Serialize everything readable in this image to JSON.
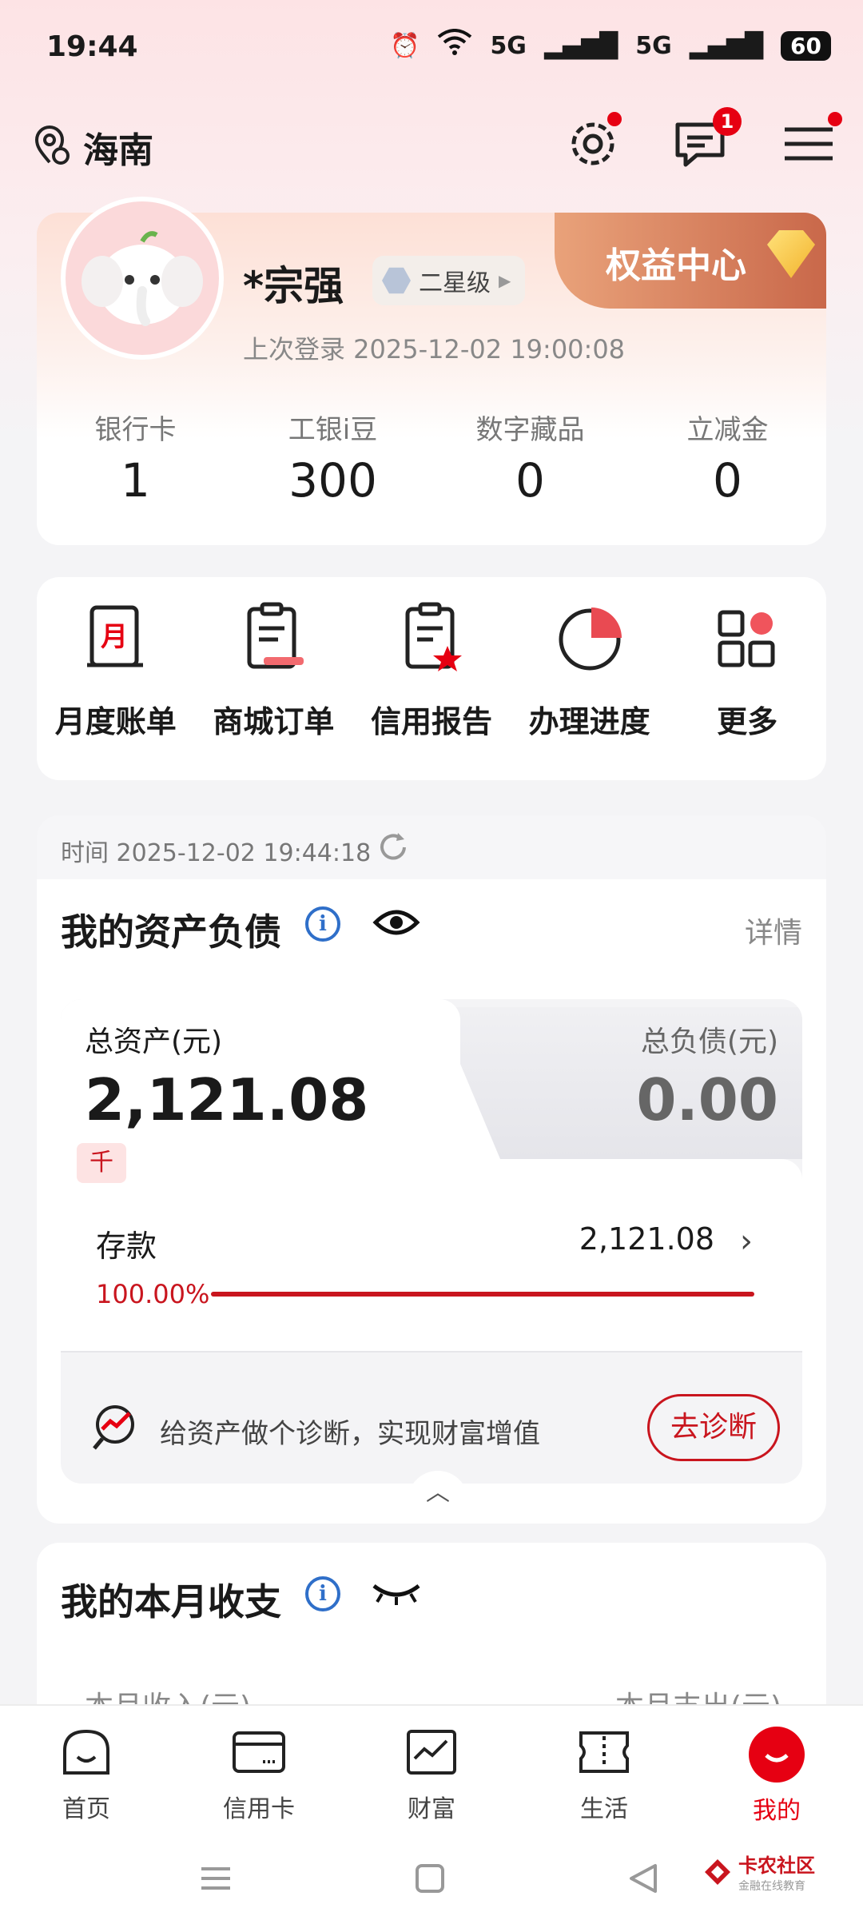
{
  "status_bar": {
    "time": "19:44",
    "signal1": "5G",
    "signal2": "5G",
    "battery": "60"
  },
  "header": {
    "location": "海南",
    "messages_badge": "1"
  },
  "profile": {
    "name": "*宗强",
    "level": "二星级",
    "rights_center": "权益中心",
    "last_login": "上次登录 2025-12-02 19:00:08",
    "stats": [
      {
        "label": "银行卡",
        "value": "1"
      },
      {
        "label": "工银i豆",
        "value": "300"
      },
      {
        "label": "数字藏品",
        "value": "0"
      },
      {
        "label": "立减金",
        "value": "0"
      }
    ]
  },
  "quick_menu": [
    {
      "label": "月度账单",
      "icon": "monthly-bill-icon"
    },
    {
      "label": "商城订单",
      "icon": "mall-order-icon"
    },
    {
      "label": "信用报告",
      "icon": "credit-report-icon"
    },
    {
      "label": "办理进度",
      "icon": "progress-pie-icon"
    },
    {
      "label": "更多",
      "icon": "more-grid-icon"
    }
  ],
  "assets": {
    "time": "时间 2025-12-02 19:44:18",
    "title": "我的资产负债",
    "details": "详情",
    "total_assets_label": "总资产(元)",
    "total_assets_value": "2,121.08",
    "unit_tag": "千",
    "total_debt_label": "总负债(元)",
    "total_debt_value": "0.00",
    "deposit_label": "存款",
    "deposit_value": "2,121.08",
    "deposit_percent": "100.00%",
    "deposit_fraction": 1.0,
    "diagnosis_text": "给资产做个诊断，实现财富增值",
    "diagnosis_button": "去诊断"
  },
  "monthly": {
    "title": "我的本月收支",
    "income_label": "本月收入(元)",
    "expense_label": "本月支出(元)"
  },
  "bottom_nav": [
    {
      "label": "首页",
      "active": false
    },
    {
      "label": "信用卡",
      "active": false
    },
    {
      "label": "财富",
      "active": false
    },
    {
      "label": "生活",
      "active": false
    },
    {
      "label": "我的",
      "active": true
    }
  ],
  "watermark": {
    "main": "卡农社区",
    "sub": "金融在线教育"
  },
  "colors": {
    "brand_red": "#e60012",
    "accent_red": "#c9151e",
    "info_blue": "#2f6fc9"
  }
}
